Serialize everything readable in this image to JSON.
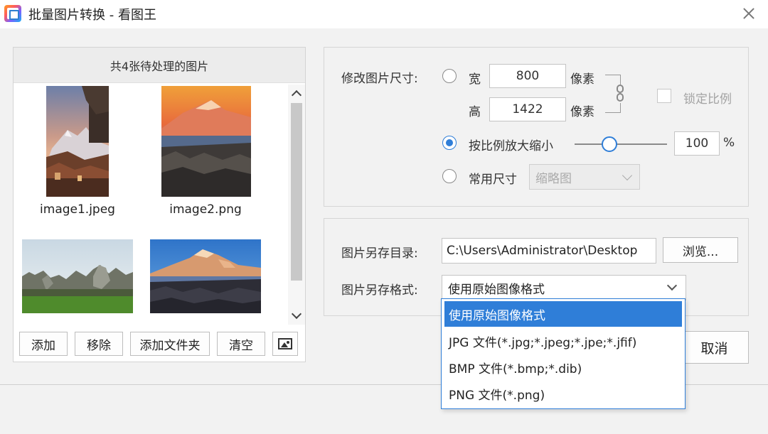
{
  "window": {
    "title": "批量图片转换 - 看图王",
    "close_label": "×"
  },
  "left_panel": {
    "header": "共4张待处理的图片",
    "images": [
      {
        "name": "image1.jpeg"
      },
      {
        "name": "image2.png"
      },
      {
        "name": ""
      },
      {
        "name": ""
      }
    ],
    "buttons": {
      "add": "添加",
      "remove": "移除",
      "add_folder": "添加文件夹",
      "clear": "清空"
    }
  },
  "size_panel": {
    "label": "修改图片尺寸:",
    "width_label": "宽",
    "width_value": "800",
    "width_unit": "像素",
    "height_label": "高",
    "height_value": "1422",
    "height_unit": "像素",
    "lock_ratio_label": "锁定比例",
    "lock_ratio_checked": false,
    "scale_label": "按比例放大缩小",
    "scale_value": "100",
    "scale_unit": "%",
    "scale_slider_fraction": 0.38,
    "preset_label": "常用尺寸",
    "preset_value": "缩略图",
    "mode_selected": "scale"
  },
  "save_panel": {
    "dir_label": "图片另存目录:",
    "dir_value": "C:\\Users\\Administrator\\Desktop",
    "browse_label": "浏览...",
    "format_label": "图片另存格式:",
    "format_value": "使用原始图像格式",
    "format_options": [
      "使用原始图像格式",
      "JPG 文件(*.jpg;*.jpeg;*.jpe;*.jfif)",
      "BMP 文件(*.bmp;*.dib)",
      "PNG 文件(*.png)"
    ]
  },
  "footer": {
    "cancel_label": "取消"
  },
  "colors": {
    "accent": "#2f7ed8",
    "background": "#f2f2f2"
  }
}
